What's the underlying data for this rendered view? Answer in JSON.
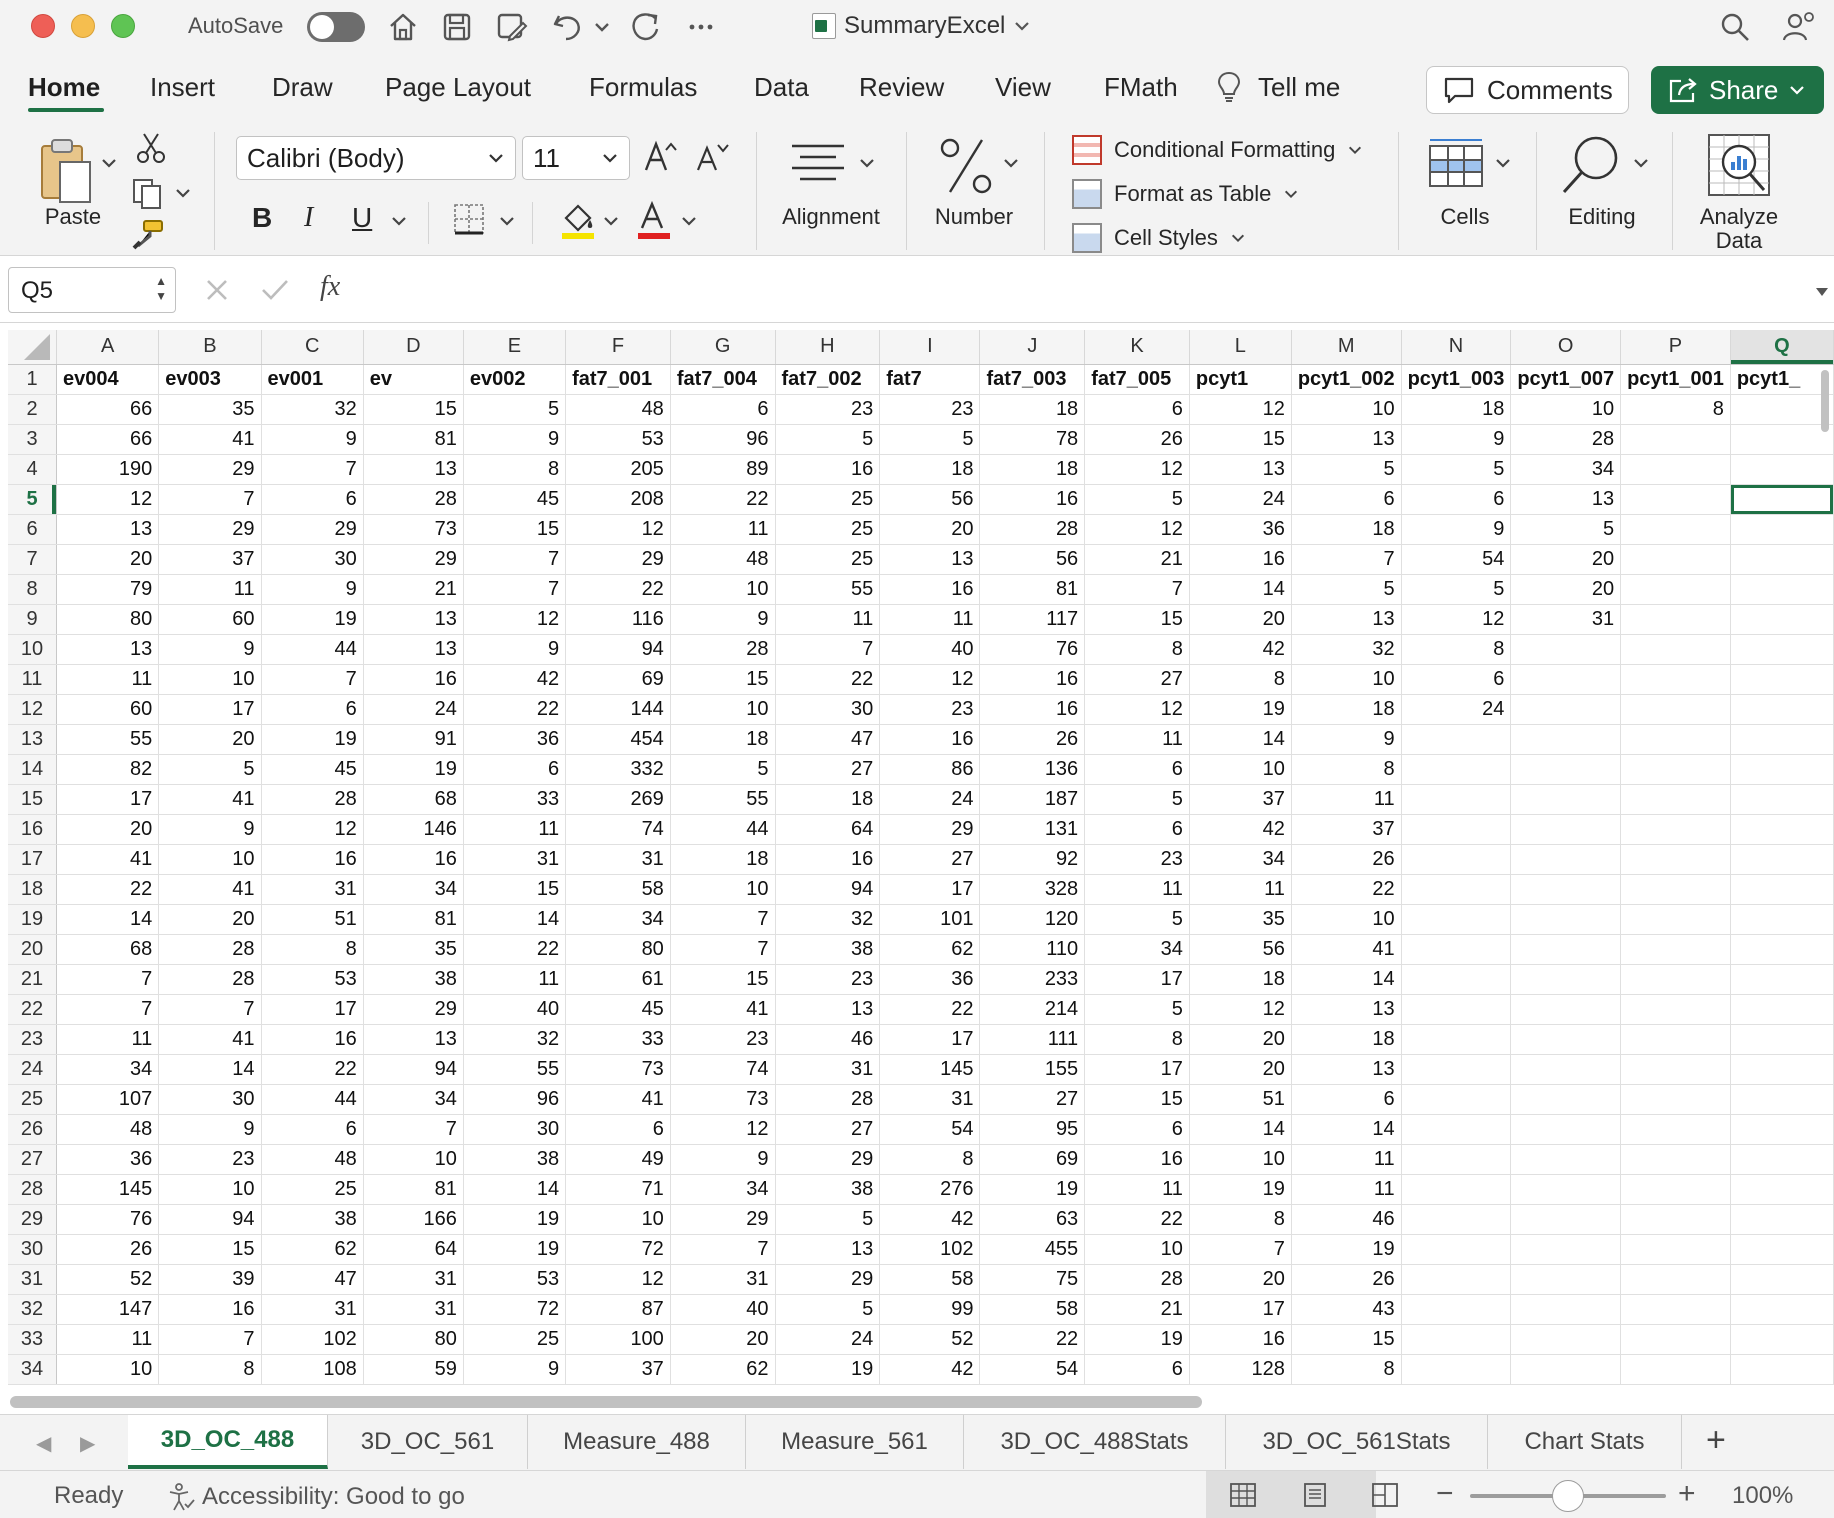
{
  "titlebar": {
    "autosave_label": "AutoSave",
    "doc_title": "SummaryExcel"
  },
  "ribbon_tabs": [
    "Home",
    "Insert",
    "Draw",
    "Page Layout",
    "Formulas",
    "Data",
    "Review",
    "View",
    "FMath",
    "Tell me"
  ],
  "ribbon": {
    "comments_label": "Comments",
    "share_label": "Share",
    "paste_label": "Paste",
    "font_name": "Calibri (Body)",
    "font_size": "11",
    "bold": "B",
    "italic": "I",
    "underline": "U",
    "alignment_label": "Alignment",
    "number_label": "Number",
    "conditional_formatting": "Conditional Formatting",
    "format_as_table": "Format as Table",
    "cell_styles": "Cell Styles",
    "cells_label": "Cells",
    "editing_label": "Editing",
    "analyze_label_1": "Analyze",
    "analyze_label_2": "Data",
    "accent_color": "#1e7145"
  },
  "formula_bar": {
    "name_box": "Q5",
    "fx": "fx",
    "formula": ""
  },
  "grid": {
    "columns": [
      "A",
      "B",
      "C",
      "D",
      "E",
      "F",
      "G",
      "H",
      "I",
      "J",
      "K",
      "L",
      "M",
      "N",
      "O",
      "P",
      "Q"
    ],
    "selected_cell": "Q5",
    "rows": [
      [
        "ev004",
        "ev003",
        "ev001",
        "ev",
        "ev002",
        "fat7_001",
        "fat7_004",
        "fat7_002",
        "fat7",
        "fat7_003",
        "fat7_005",
        "pcyt1",
        "pcyt1_002",
        "pcyt1_003",
        "pcyt1_007",
        "pcyt1_001",
        "pcyt1_"
      ],
      [
        "66",
        "35",
        "32",
        "15",
        "5",
        "48",
        "6",
        "23",
        "23",
        "18",
        "6",
        "12",
        "10",
        "18",
        "10",
        "8",
        ""
      ],
      [
        "66",
        "41",
        "9",
        "81",
        "9",
        "53",
        "96",
        "5",
        "5",
        "78",
        "26",
        "15",
        "13",
        "9",
        "28",
        "",
        ""
      ],
      [
        "190",
        "29",
        "7",
        "13",
        "8",
        "205",
        "89",
        "16",
        "18",
        "18",
        "12",
        "13",
        "5",
        "5",
        "34",
        "",
        ""
      ],
      [
        "12",
        "7",
        "6",
        "28",
        "45",
        "208",
        "22",
        "25",
        "56",
        "16",
        "5",
        "24",
        "6",
        "6",
        "13",
        "",
        ""
      ],
      [
        "13",
        "29",
        "29",
        "73",
        "15",
        "12",
        "11",
        "25",
        "20",
        "28",
        "12",
        "36",
        "18",
        "9",
        "5",
        "",
        ""
      ],
      [
        "20",
        "37",
        "30",
        "29",
        "7",
        "29",
        "48",
        "25",
        "13",
        "56",
        "21",
        "16",
        "7",
        "54",
        "20",
        "",
        ""
      ],
      [
        "79",
        "11",
        "9",
        "21",
        "7",
        "22",
        "10",
        "55",
        "16",
        "81",
        "7",
        "14",
        "5",
        "5",
        "20",
        "",
        ""
      ],
      [
        "80",
        "60",
        "19",
        "13",
        "12",
        "116",
        "9",
        "11",
        "11",
        "117",
        "15",
        "20",
        "13",
        "12",
        "31",
        "",
        ""
      ],
      [
        "13",
        "9",
        "44",
        "13",
        "9",
        "94",
        "28",
        "7",
        "40",
        "76",
        "8",
        "42",
        "32",
        "8",
        "",
        "",
        ""
      ],
      [
        "11",
        "10",
        "7",
        "16",
        "42",
        "69",
        "15",
        "22",
        "12",
        "16",
        "27",
        "8",
        "10",
        "6",
        "",
        "",
        ""
      ],
      [
        "60",
        "17",
        "6",
        "24",
        "22",
        "144",
        "10",
        "30",
        "23",
        "16",
        "12",
        "19",
        "18",
        "24",
        "",
        "",
        ""
      ],
      [
        "55",
        "20",
        "19",
        "91",
        "36",
        "454",
        "18",
        "47",
        "16",
        "26",
        "11",
        "14",
        "9",
        "",
        "",
        "",
        ""
      ],
      [
        "82",
        "5",
        "45",
        "19",
        "6",
        "332",
        "5",
        "27",
        "86",
        "136",
        "6",
        "10",
        "8",
        "",
        "",
        "",
        ""
      ],
      [
        "17",
        "41",
        "28",
        "68",
        "33",
        "269",
        "55",
        "18",
        "24",
        "187",
        "5",
        "37",
        "11",
        "",
        "",
        "",
        ""
      ],
      [
        "20",
        "9",
        "12",
        "146",
        "11",
        "74",
        "44",
        "64",
        "29",
        "131",
        "6",
        "42",
        "37",
        "",
        "",
        "",
        ""
      ],
      [
        "41",
        "10",
        "16",
        "16",
        "31",
        "31",
        "18",
        "16",
        "27",
        "92",
        "23",
        "34",
        "26",
        "",
        "",
        "",
        ""
      ],
      [
        "22",
        "41",
        "31",
        "34",
        "15",
        "58",
        "10",
        "94",
        "17",
        "328",
        "11",
        "11",
        "22",
        "",
        "",
        "",
        ""
      ],
      [
        "14",
        "20",
        "51",
        "81",
        "14",
        "34",
        "7",
        "32",
        "101",
        "120",
        "5",
        "35",
        "10",
        "",
        "",
        "",
        ""
      ],
      [
        "68",
        "28",
        "8",
        "35",
        "22",
        "80",
        "7",
        "38",
        "62",
        "110",
        "34",
        "56",
        "41",
        "",
        "",
        "",
        ""
      ],
      [
        "7",
        "28",
        "53",
        "38",
        "11",
        "61",
        "15",
        "23",
        "36",
        "233",
        "17",
        "18",
        "14",
        "",
        "",
        "",
        ""
      ],
      [
        "7",
        "7",
        "17",
        "29",
        "40",
        "45",
        "41",
        "13",
        "22",
        "214",
        "5",
        "12",
        "13",
        "",
        "",
        "",
        ""
      ],
      [
        "11",
        "41",
        "16",
        "13",
        "32",
        "33",
        "23",
        "46",
        "17",
        "111",
        "8",
        "20",
        "18",
        "",
        "",
        "",
        ""
      ],
      [
        "34",
        "14",
        "22",
        "94",
        "55",
        "73",
        "74",
        "31",
        "145",
        "155",
        "17",
        "20",
        "13",
        "",
        "",
        "",
        ""
      ],
      [
        "107",
        "30",
        "44",
        "34",
        "96",
        "41",
        "73",
        "28",
        "31",
        "27",
        "15",
        "51",
        "6",
        "",
        "",
        "",
        ""
      ],
      [
        "48",
        "9",
        "6",
        "7",
        "30",
        "6",
        "12",
        "27",
        "54",
        "95",
        "6",
        "14",
        "14",
        "",
        "",
        "",
        ""
      ],
      [
        "36",
        "23",
        "48",
        "10",
        "38",
        "49",
        "9",
        "29",
        "8",
        "69",
        "16",
        "10",
        "11",
        "",
        "",
        "",
        ""
      ],
      [
        "145",
        "10",
        "25",
        "81",
        "14",
        "71",
        "34",
        "38",
        "276",
        "19",
        "11",
        "19",
        "11",
        "",
        "",
        "",
        ""
      ],
      [
        "76",
        "94",
        "38",
        "166",
        "19",
        "10",
        "29",
        "5",
        "42",
        "63",
        "22",
        "8",
        "46",
        "",
        "",
        "",
        ""
      ],
      [
        "26",
        "15",
        "62",
        "64",
        "19",
        "72",
        "7",
        "13",
        "102",
        "455",
        "10",
        "7",
        "19",
        "",
        "",
        "",
        ""
      ],
      [
        "52",
        "39",
        "47",
        "31",
        "53",
        "12",
        "31",
        "29",
        "58",
        "75",
        "28",
        "20",
        "26",
        "",
        "",
        "",
        ""
      ],
      [
        "147",
        "16",
        "31",
        "31",
        "72",
        "87",
        "40",
        "5",
        "99",
        "58",
        "21",
        "17",
        "43",
        "",
        "",
        "",
        ""
      ],
      [
        "11",
        "7",
        "102",
        "80",
        "25",
        "100",
        "20",
        "24",
        "52",
        "22",
        "19",
        "16",
        "15",
        "",
        "",
        "",
        ""
      ],
      [
        "10",
        "8",
        "108",
        "59",
        "9",
        "37",
        "62",
        "19",
        "42",
        "54",
        "6",
        "128",
        "8",
        "",
        "",
        "",
        ""
      ]
    ]
  },
  "sheet_tabs": [
    "3D_OC_488",
    "3D_OC_561",
    "Measure_488",
    "Measure_561",
    "3D_OC_488Stats",
    "3D_OC_561Stats",
    "Chart Stats"
  ],
  "active_sheet": "3D_OC_488",
  "statusbar": {
    "ready": "Ready",
    "accessibility": "Accessibility: Good to go",
    "zoom": "100%"
  }
}
